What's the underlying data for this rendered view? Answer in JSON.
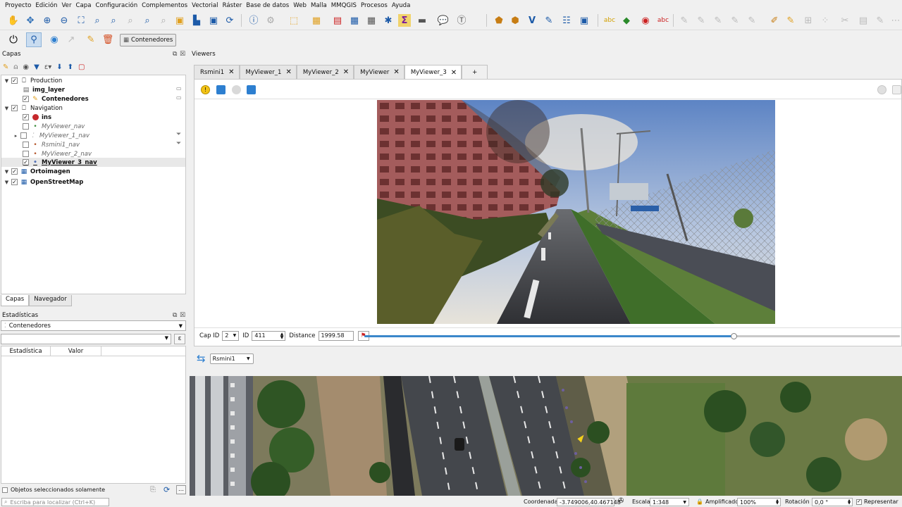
{
  "menubar": [
    "Proyecto",
    "Edición",
    "Ver",
    "Capa",
    "Configuración",
    "Complementos",
    "Vectorial",
    "Ráster",
    "Base de datos",
    "Web",
    "Malla",
    "MMQGIS",
    "Procesos",
    "Ayuda"
  ],
  "toolbar2": {
    "contenedores_label": "Contenedores"
  },
  "layers_panel": {
    "title": "Capas"
  },
  "layers": [
    {
      "label": "Production",
      "group": true,
      "checked": true
    },
    {
      "label": "img_layer"
    },
    {
      "label": "Contenedores",
      "checked": true
    },
    {
      "label": "Navigation",
      "group": true,
      "checked": true
    },
    {
      "label": "ins",
      "checked": true
    },
    {
      "label": "MyViewer_nav",
      "checked": false
    },
    {
      "label": "MyViewer_1_nav",
      "checked": false
    },
    {
      "label": "Rsmini1_nav",
      "checked": false
    },
    {
      "label": "MyViewer_2_nav",
      "checked": false
    },
    {
      "label": "MyViewer_3_nav",
      "checked": true
    },
    {
      "label": "Ortoimagen",
      "checked": true
    },
    {
      "label": "OpenStreetMap",
      "checked": true
    }
  ],
  "bottom_tabs": [
    "Capas",
    "Navegador"
  ],
  "stats": {
    "title": "Estadísticas",
    "layer_combo": "Contenedores",
    "col_stat": "Estadística",
    "col_value": "Valor",
    "selected_only": "Objetos seleccionados solamente"
  },
  "viewers": {
    "title": "Viewers",
    "tabs": [
      "Rsmini1",
      "MyViewer_1",
      "MyViewer_2",
      "MyViewer",
      "MyViewer_3"
    ],
    "active_tab": "MyViewer_3",
    "add_tab": "+",
    "cap_id_label": "Cap ID",
    "cap_id_value": "2",
    "id_label": "ID",
    "id_value": "411",
    "distance_label": "Distance",
    "distance_value": "1999.58",
    "slider_fraction": 0.69,
    "sync_combo": "Rsmini1"
  },
  "statusbar": {
    "search_placeholder": "Escriba para localizar (Ctrl+K)",
    "coord_label": "Coordenada",
    "coord_value": "-3.749006,40.467148",
    "scale_label": "Escala",
    "scale_value": "1:348",
    "magnifier_label": "Amplificador",
    "magnifier_value": "100%",
    "rotation_label": "Rotación",
    "rotation_value": "0,0 °",
    "render_label": "Representar"
  },
  "colors": {
    "accent": "#3b87cb",
    "ins_red": "#c6282c"
  }
}
